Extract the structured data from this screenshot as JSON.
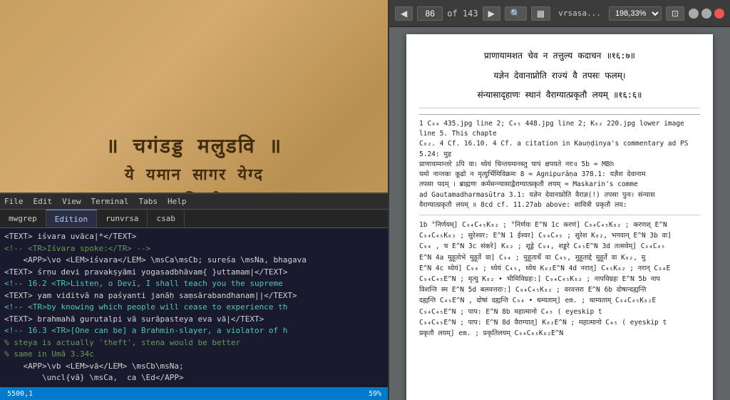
{
  "bg": {
    "sanskrit_lines": [
      "॥ राॅगड्ड॥मलुडवि॥",
      "येयमान॥सागर॥येग्द॥"
    ]
  },
  "editor": {
    "menu_items": [
      "File",
      "Edit",
      "View",
      "Terminal",
      "Tabs",
      "Help"
    ],
    "tabs": [
      {
        "label": "mwgrep",
        "active": false
      },
      {
        "label": "Edition",
        "active": true
      },
      {
        "label": "runvrsa",
        "active": false
      },
      {
        "label": "csab",
        "active": false
      }
    ],
    "lines": [
      {
        "text": "<TEXT> iśvara uvāca|*</TEXT>"
      },
      {
        "text": "<!-- <TR>Iśvara spoke:</TR> -->"
      },
      {
        "text": "    <APP>\\vo <LEM>iśvara</LEM> \\msCa\\msCb; sureśa \\msNa, bhagava"
      },
      {
        "text": "<TEXT> śrṇu devi pravakṣyāmi yogasadbhāvam{ }uttamam|</TEXT>"
      },
      {
        "text": "<!-- 16.2 <TR>Listen, o Devī, I shall teach you the supreme"
      },
      {
        "text": "<TEXT> yam viditvā na paśyanti janāḥ saṃsārabandhanam||</TEXT>"
      },
      {
        "text": "<!-- <TR>by knowing which people will cease to experience th"
      },
      {
        "text": "<TEXT> brahmahā gurutalpi vā surāpasteya eva vā|</TEXT>"
      },
      {
        "text": "<!-- 16.3 <TR>[One can be] a Brahmin-slayer, a violator of h"
      },
      {
        "text": "% steya is actually 'theft', stena would be better"
      },
      {
        "text": "% same in Umā 3.34c"
      },
      {
        "text": "    <APP>\\vb <LEM>vā</LEM> \\msCb\\msNa;"
      },
      {
        "text": "        \\uncl{vā} \\msCa,  ca \\Ed</APP>"
      }
    ],
    "statusbar": {
      "left": "5500,1",
      "right": "59%"
    }
  },
  "pdf": {
    "toolbar": {
      "page_num": "86",
      "of_label": "of 143",
      "zoom": "198,33%",
      "title": "vrsasa...",
      "nav_prev": "◀",
      "nav_next": "▶",
      "search_icon": "🔍",
      "menu_icon": "≡",
      "minimize": "–",
      "maximize": "□",
      "close": "✕"
    },
    "content": {
      "sanskrit1": "प्राणायामशत चेव न तत्तुल्य कदाचन ॥१६:७॥",
      "sanskrit2": "यज्ञेन देवानाप्नोति राज्यं वै तपसः फलम्।",
      "sanskrit3": "संन्यासादृहाणः स्थानं वैराग्यात्प्रकृतौ लयम् ॥१६:६॥",
      "footnote1": "1 C₉₄ 435.jpg line 2; C₄₅ 448.jpg line 2; K₈₂ 220.jpg lower image line 5. This chapte",
      "footnote2": "C₀₂.  4 Cf. 16.10.   4 Cf. a citation in Kauṇḍinya's commentary ad PS 5.24: मुह",
      "footnote3": "प्राणायामान्तरे ऽपि वा। ध्येयं चिन्तयमानस्तु पापं क्षपयते नरः॥   5b ≈ MBh",
      "footnote4": "यमो नान्तकः कूढो न मृत्युर्भिमिविक्रमः   8 ≈  Agnipurāṇa 378.1: यज्ञैश देवानाम",
      "footnote5": "तपसा पदम् । ब्राह्मणः कर्मसन्न्यासाद्वैराग्यात्प्रकृतौ लयम् ≈  Maskarin's comme",
      "footnote6": "ad Gautamadharmasūtra 3.1: यज्ञेन देवानाप्नोति वैराज्ञ(!) तपसा पुनः। संन्यास",
      "footnote7": "वैराग्यात्प्रकृतौ लयम् ॥  8cd cf. 11.27ab above: सावित्री प्रकृतौ लय:",
      "apparatus": "1b °निर्णयम्] C₉₄C₄₅K₈₂ ; °निर्णयः  E^N   1c करणं] C₉₄C₄₅K₈₂ ;  करणश्  E^N",
      "apparatus2": "C₉₄C₄₅K₈₂ ;  सुरेश्वर:  E^N   1 ईश्वर] C₉₄C₄₅ ;  सुरेश K₈₂,  भगवान् E^N   3b वा]",
      "apparatus3": "C₉₄ ,  च  E^N   3c संकरे] K₈₂ ;  शूड्रे  C₉₄,  शड्डरे  C₄₅E^N   3d तत्सवेम्] C₉₄C₄₅",
      "apparatus4": "E^N   4a मुहूतोभे मुहूर्ते वा] C₉₄ ;  मुहूतार्थे वा C₄₅,  मुहूताद्दे मुहूर्ते वा K₈₂, मु",
      "apparatus5": "E^N   4c ध्येयं] C₉₄ ;  ध्येयं C₄₅,  ध्येय K₈₂E^N   4d नरात्] C₄₅K₈₂ ;  नरान् C₉₄E",
      "apparatus6": "C₉₄C₄₅E^N ;  मृत्यु K₈₂ •  भीमिविग्रहः:] C₉₄C₄₅K₈₂ ;  नापविग्रहः  E^N   5b नाप",
      "apparatus7": "विशन्ति स्म  E^N   5d बलवत्तराः:] C₉₄C₄₅K₈₂ ;  वरवत्तरा  E^N   6b दोषान्दह्यन्ति",
      "apparatus8": "दह्यन्ति C₄₅E^N ,  दोषां दह्यन्ति C₉₄ • धम्यताम्] em. ;  धाम्यताम् C₉₄C₄₅K₈₂E",
      "apparatus9": "C₉₄C₄₅E^N ;  पाप:  E^N   8b महात्मानो C₄₅  ( eyeskip t",
      "apparatus10": "C₉₄C₄₅E^N ;  पाप:  E^N   8d वैराग्यात्] K₈₂E^N ;  महात्मानो C₄₅  ( eyeskip t",
      "apparatus11": "प्रकृतौ लयम्] em. ;  प्रकृतिलयम्  C₉₄C₄₅K₈₂E^N"
    }
  }
}
